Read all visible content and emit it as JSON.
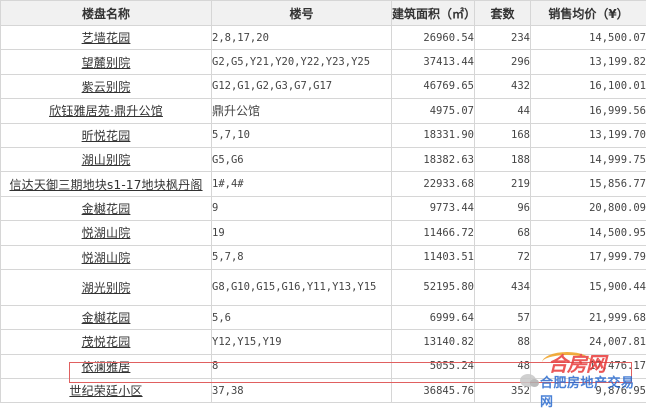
{
  "columns": [
    "楼盘名称",
    "楼号",
    "建筑面积（㎡）",
    "套数",
    "销售均价（¥）"
  ],
  "rows": [
    {
      "name": "艺墙花园",
      "buildings": "2,8,17,20",
      "area": "26960.54",
      "units": "234",
      "price": "14,500.07"
    },
    {
      "name": "望麓别院",
      "buildings": "G2,G5,Y21,Y20,Y22,Y23,Y25",
      "area": "37413.44",
      "units": "296",
      "price": "13,199.82"
    },
    {
      "name": "紫云别院",
      "buildings": "G12,G1,G2,G3,G7,G17",
      "area": "46769.65",
      "units": "432",
      "price": "16,100.01"
    },
    {
      "name": "欣钰雅居苑·鼎升公馆",
      "buildings": "鼎升公馆",
      "area": "4975.07",
      "units": "44",
      "price": "16,999.56"
    },
    {
      "name": "昕悦花园",
      "buildings": "5,7,10",
      "area": "18331.90",
      "units": "168",
      "price": "13,199.70"
    },
    {
      "name": "湖山别院",
      "buildings": "G5,G6",
      "area": "18382.63",
      "units": "188",
      "price": "14,999.75"
    },
    {
      "name": "信达天御三期地块s1-17地块枫丹阁",
      "buildings": "1#,4#",
      "area": "22933.68",
      "units": "219",
      "price": "15,856.77"
    },
    {
      "name": "金樾花园",
      "buildings": "9",
      "area": "9773.44",
      "units": "96",
      "price": "20,800.09"
    },
    {
      "name": "悦湖山院",
      "buildings": "19",
      "area": "11466.72",
      "units": "68",
      "price": "14,500.95"
    },
    {
      "name": "悦湖山院",
      "buildings": "5,7,8",
      "area": "11403.51",
      "units": "72",
      "price": "17,999.79"
    },
    {
      "name": "湖光别院",
      "buildings": "G8,G10,G15,G16,Y11,Y13,Y15",
      "area": "52195.80",
      "units": "434",
      "price": "15,900.44"
    },
    {
      "name": "金樾花园",
      "buildings": "5,6",
      "area": "6999.64",
      "units": "57",
      "price": "21,999.68"
    },
    {
      "name": "茂悦花园",
      "buildings": "Y12,Y15,Y19",
      "area": "13140.82",
      "units": "88",
      "price": "24,007.81"
    },
    {
      "name": "依澜雅居",
      "buildings": "8",
      "area": "5055.24",
      "units": "48",
      "price": "17,476.17"
    },
    {
      "name": "世纪荣廷小区",
      "buildings": "37,38",
      "area": "36845.76",
      "units": "352",
      "price": "9,876.95"
    }
  ],
  "watermark": {
    "logo": "合房网",
    "site": "合肥房地产交易网"
  },
  "colors": {
    "header_bg": "#f1f1f1",
    "border": "#d6d6d6",
    "highlight": "#e06060",
    "watermark_red": "#e83a3a",
    "watermark_blue": "#2a6bd0"
  }
}
